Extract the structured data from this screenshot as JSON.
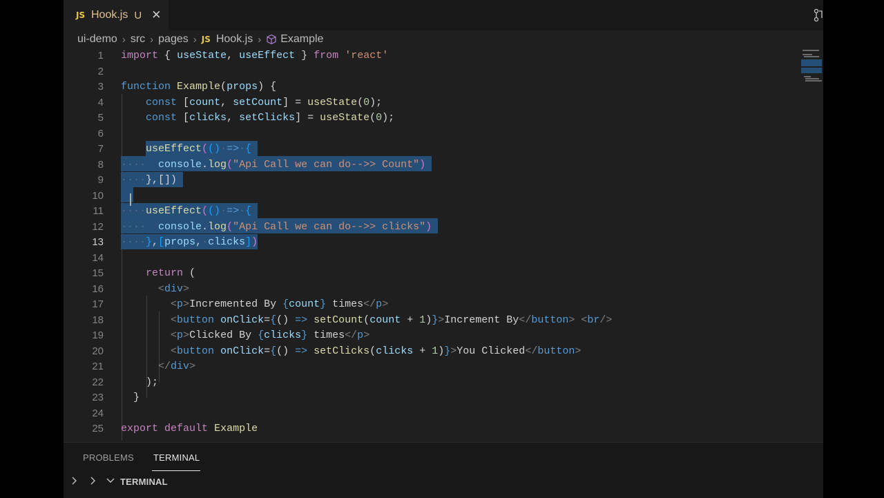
{
  "tab": {
    "badge": "JS",
    "name": "Hook.js",
    "status": "U",
    "close": "✕"
  },
  "breadcrumb": {
    "root": "ui-demo",
    "src": "src",
    "pages": "pages",
    "file_badge": "JS",
    "file": "Hook.js",
    "symbol": "Example"
  },
  "lines": [
    "1",
    "2",
    "3",
    "4",
    "5",
    "6",
    "7",
    "8",
    "9",
    "10",
    "11",
    "12",
    "13",
    "14",
    "15",
    "16",
    "17",
    "18",
    "19",
    "20",
    "21",
    "22",
    "23",
    "24",
    "25"
  ],
  "code": {
    "l1": {
      "import": "import",
      "open": "{",
      "useState": "useState",
      "comma": ",",
      "useEffect": "useEffect",
      "close": "}",
      "from": "from",
      "module": "'react'"
    },
    "l3": {
      "function": "function",
      "name": "Example",
      "params": "props"
    },
    "l4": {
      "const": "const",
      "count": "count",
      "setCount": "setCount",
      "useState": "useState",
      "init": "0"
    },
    "l5": {
      "const": "const",
      "clicks": "clicks",
      "setClicks": "setClicks",
      "useState": "useState",
      "init": "0"
    },
    "l7": {
      "useEffect": "useEffect",
      "arrow": "=>"
    },
    "l8": {
      "console": "console",
      "log": "log",
      "str": "\"Api Call we can do-->> Count\""
    },
    "l9": {
      "close": "},[])"
    },
    "l11": {
      "useEffect": "useEffect",
      "arrow": "=>"
    },
    "l12": {
      "console": "console",
      "log": "log",
      "str": "\"Api Call we can do-->> clicks\""
    },
    "l13": {
      "props": "props",
      "clicks": "clicks"
    },
    "l15": {
      "return": "return"
    },
    "l16": {
      "div": "div"
    },
    "l17": {
      "p": "p",
      "text1": "Incremented By ",
      "count": "count",
      "text2": " times"
    },
    "l18": {
      "button": "button",
      "attr": "onClick",
      "setCount": "setCount",
      "count": "count",
      "one": "1",
      "text": "Increment By",
      "br": "br"
    },
    "l19": {
      "p": "p",
      "text1": "Clicked By ",
      "clicks": "clicks",
      "text2": " times"
    },
    "l20": {
      "button": "button",
      "attr": "onClick",
      "setClicks": "setClicks",
      "clicks": "clicks",
      "one": "1",
      "text": "You Clicked"
    },
    "l21": {
      "div": "div"
    },
    "l25": {
      "export": "export",
      "default": "default",
      "name": "Example"
    }
  },
  "panel": {
    "problems": "PROBLEMS",
    "terminal": "TERMINAL",
    "section": "TERMINAL"
  },
  "colors": {
    "editor_bg": "#1f1f1f",
    "selection": "#264f78",
    "keyword": "#c586c0",
    "function": "#dcdcaa",
    "variable": "#9cdcfe",
    "string": "#ce9178"
  }
}
